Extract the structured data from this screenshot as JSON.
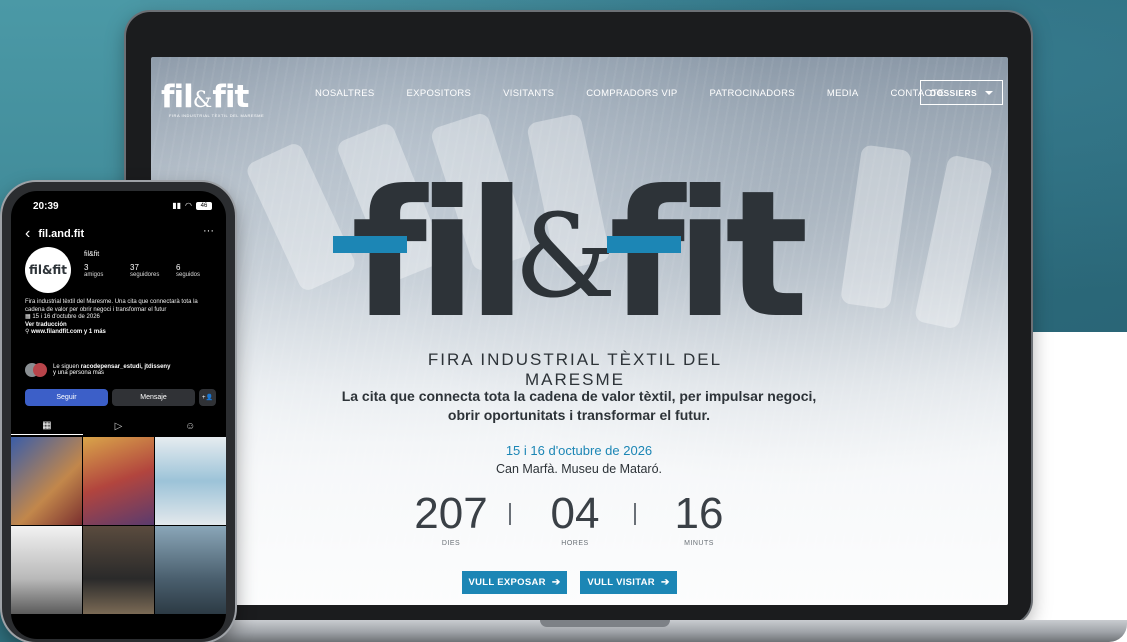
{
  "site": {
    "logo_word1": "fil",
    "logo_amp": "&",
    "logo_word2": "fit",
    "logo_tag": "FIRA INDUSTRIAL TÈXTIL DEL MARESME",
    "nav": [
      "NOSALTRES",
      "EXPOSITORS",
      "VISITANTS",
      "COMPRADORS VIP",
      "PATROCINADORS",
      "MEDIA",
      "CONTACTE"
    ],
    "dossiers_label": "DOSSIERS",
    "hero": {
      "tagline": "FIRA INDUSTRIAL TÈXTIL DEL MARESME",
      "description_line1": "La cita que connecta tota la cadena de valor tèxtil, per impulsar negoci,",
      "description_line2": "obrir oportunitats i transformar el futur.",
      "date": "15 i 16 d'octubre de 2026",
      "venue": "Can Marfà. Museu de Mataró."
    },
    "countdown": [
      {
        "value": "207",
        "label": "DIES"
      },
      {
        "value": "04",
        "label": "HORES"
      },
      {
        "value": "16",
        "label": "MINUTS"
      }
    ],
    "cta": {
      "exposar": "VULL EXPOSAR",
      "visitar": "VULL VISITAR",
      "arrow": "➔"
    },
    "colors": {
      "accent": "#1c86b5",
      "dark": "#2d3338"
    }
  },
  "phone": {
    "time": "20:39",
    "battery": "46",
    "username": "fil.and.fit",
    "back_icon": "‹",
    "menu_icon": "···",
    "avatar_text": "fil&fit",
    "display_name": "fil&fit",
    "stats": [
      {
        "value": "3",
        "label": "amigos"
      },
      {
        "value": "37",
        "label": "seguidores"
      },
      {
        "value": "6",
        "label": "seguidos"
      }
    ],
    "bio": "Fira industrial tèxtil del Maresme. Una cita que connectarà tota la cadena de valor per obrir negoci i transformar el futur",
    "bio_date": "15 i 16 d'octubre de 2026",
    "bio_translate": "Ver traducción",
    "bio_link": "www.filandfit.com y 1 más",
    "followed_by_prefix": "Le siguen ",
    "followed_by_names": "racodepensar_estudi, jtdisseny",
    "followed_by_suffix": "y una persona más",
    "follow_button": "Seguir",
    "message_button": "Mensaje",
    "add_user_icon": "+👤",
    "tab_icons": [
      "▦",
      "▷",
      "☺"
    ]
  }
}
